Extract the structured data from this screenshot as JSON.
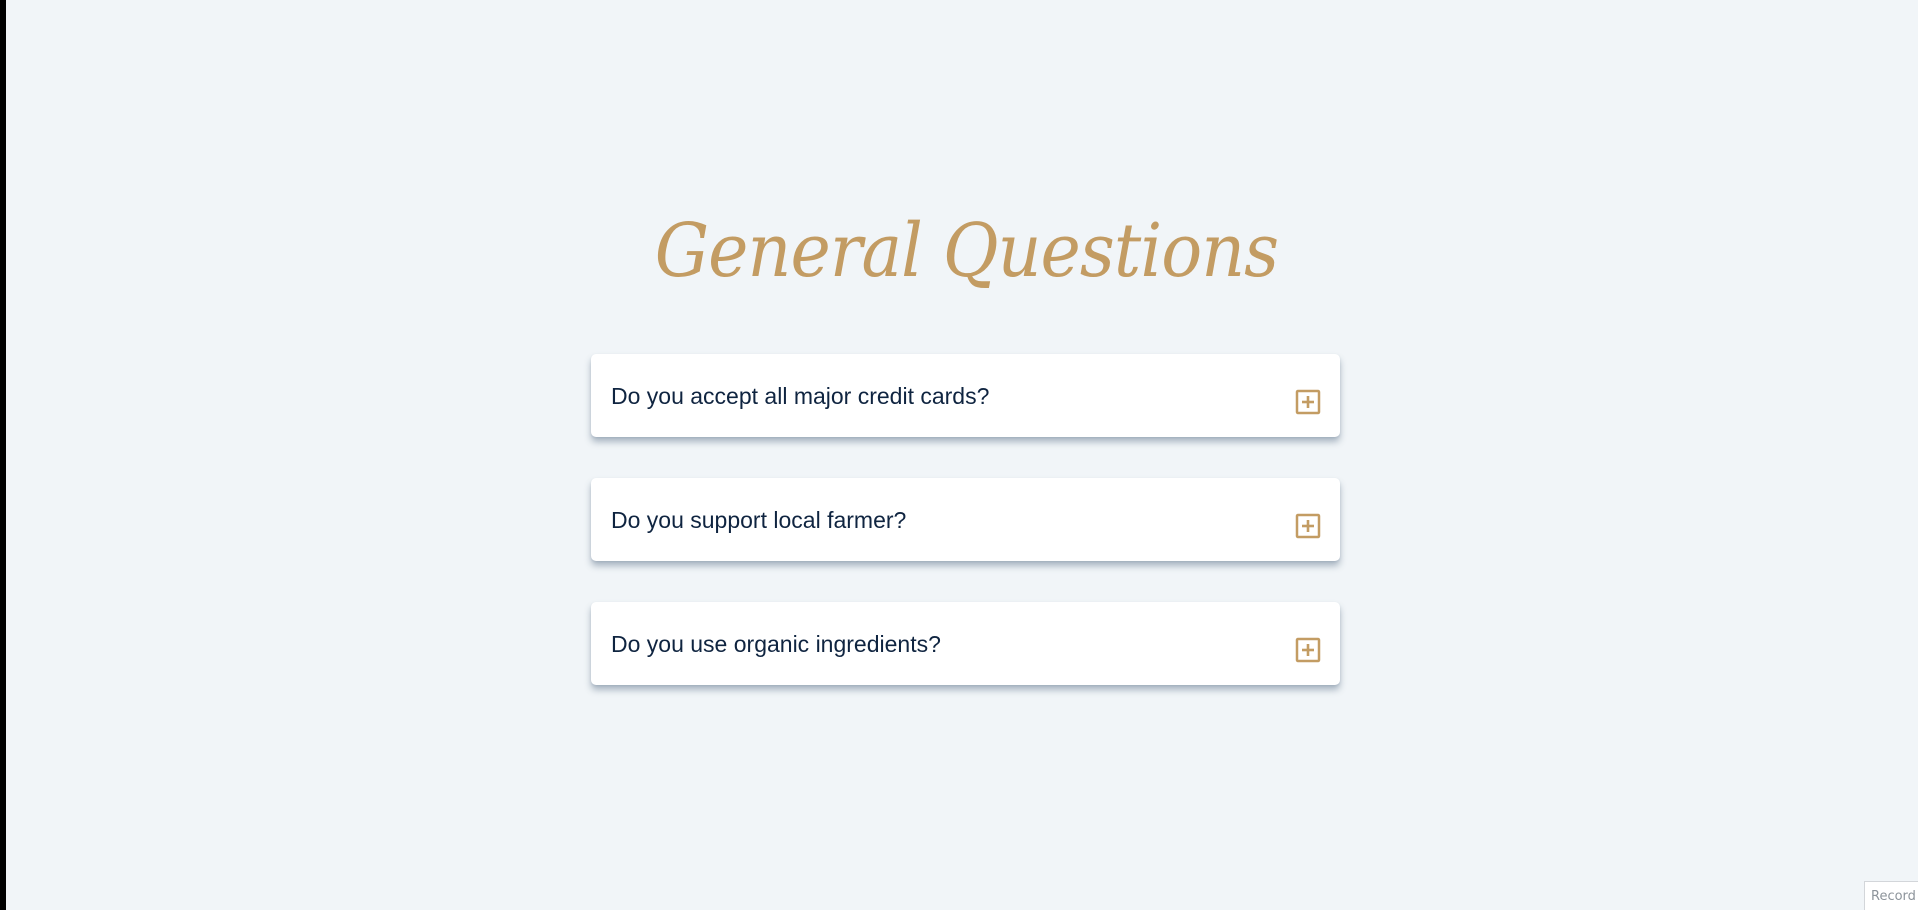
{
  "page": {
    "title": "General Questions"
  },
  "faq": {
    "items": [
      {
        "question": "Do you accept all major credit cards?",
        "toggle_icon": "plus-square-icon"
      },
      {
        "question": "Do you support local farmer?",
        "toggle_icon": "plus-square-icon"
      },
      {
        "question": "Do you use organic ingredients?",
        "toggle_icon": "plus-square-icon"
      }
    ]
  },
  "widget": {
    "record_label": "Record"
  },
  "colors": {
    "background": "#f1f5f8",
    "accent_gold": "#c39c63",
    "question_text": "#0f2440",
    "card": "#ffffff"
  }
}
